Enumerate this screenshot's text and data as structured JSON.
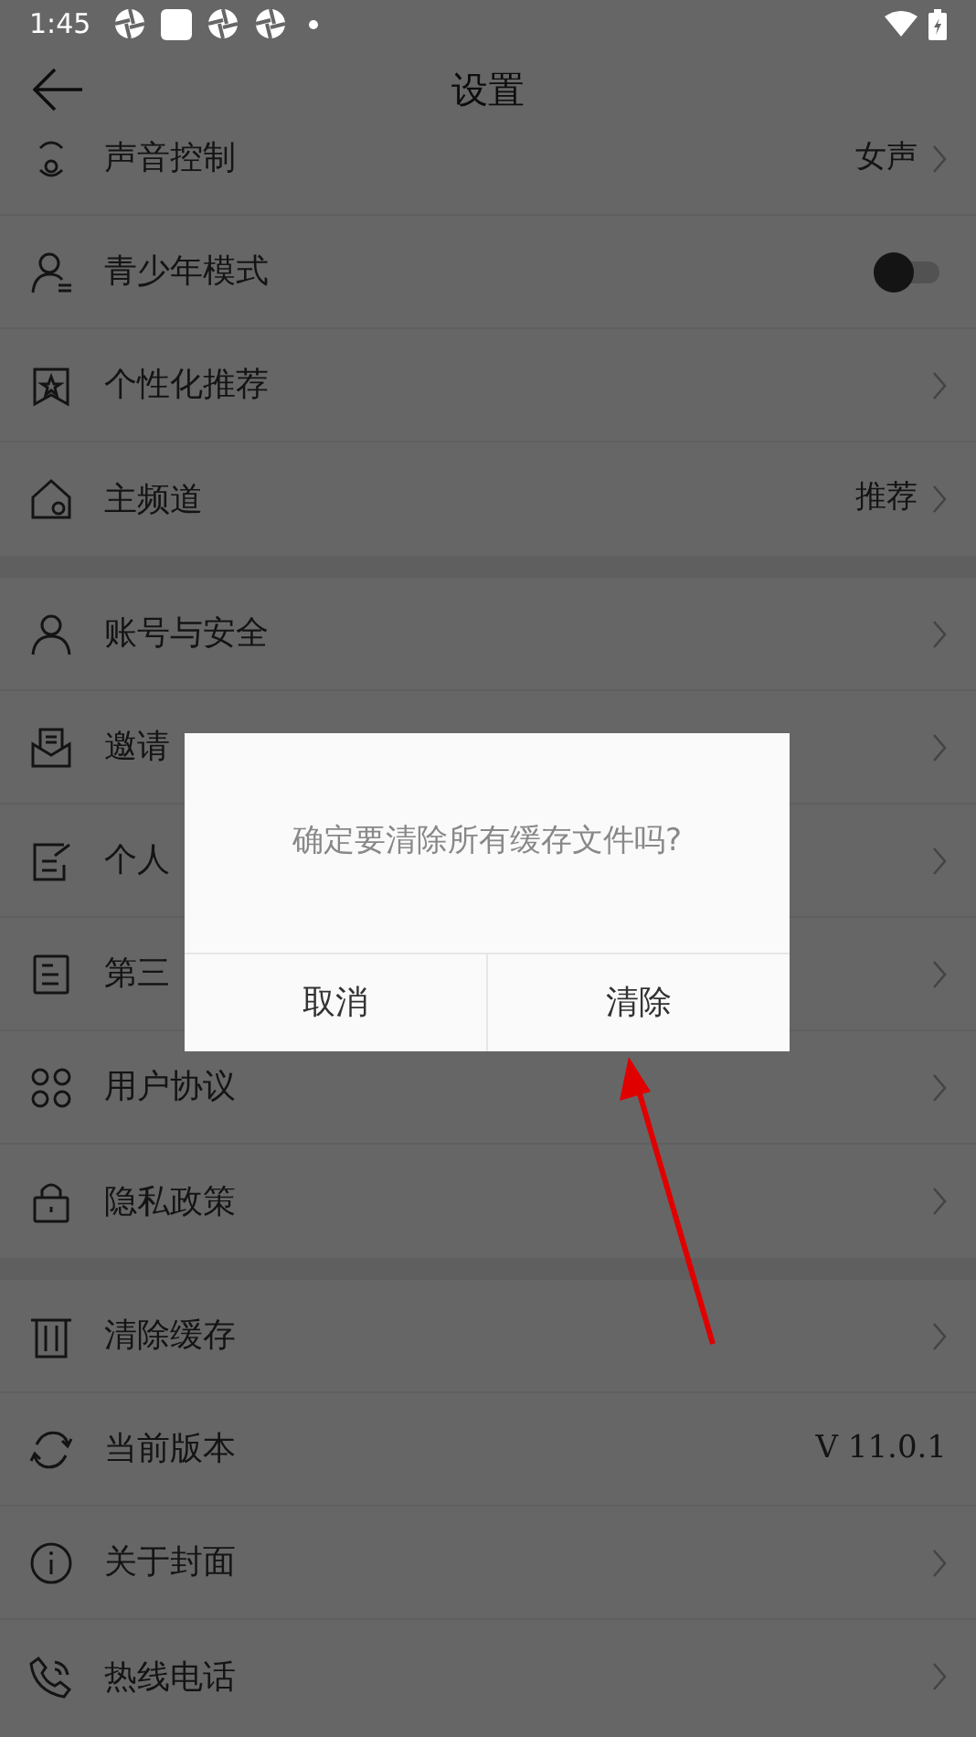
{
  "status_bar": {
    "time": "1:45"
  },
  "header": {
    "title": "设置"
  },
  "sections": [
    {
      "rows": [
        {
          "kind": "link",
          "label": "声音控制",
          "value": "女声"
        },
        {
          "kind": "toggle",
          "label": "青少年模式",
          "on": false
        },
        {
          "kind": "link",
          "label": "个性化推荐"
        },
        {
          "kind": "link",
          "label": "主频道",
          "value": "推荐"
        }
      ]
    },
    {
      "rows": [
        {
          "kind": "link",
          "label": "账号与安全"
        },
        {
          "kind": "link",
          "label": "邀请"
        },
        {
          "kind": "link",
          "label": "个人"
        },
        {
          "kind": "link",
          "label": "第三"
        },
        {
          "kind": "link",
          "label": "用户协议"
        },
        {
          "kind": "link",
          "label": "隐私政策"
        }
      ]
    },
    {
      "rows": [
        {
          "kind": "link",
          "label": "清除缓存"
        },
        {
          "kind": "info",
          "label": "当前版本",
          "value": "V 11.0.1"
        },
        {
          "kind": "link",
          "label": "关于封面"
        },
        {
          "kind": "link",
          "label": "热线电话"
        }
      ]
    }
  ],
  "dialog": {
    "message": "确定要清除所有缓存文件吗?",
    "buttons": [
      {
        "label": "取消"
      },
      {
        "label": "清除"
      }
    ]
  }
}
